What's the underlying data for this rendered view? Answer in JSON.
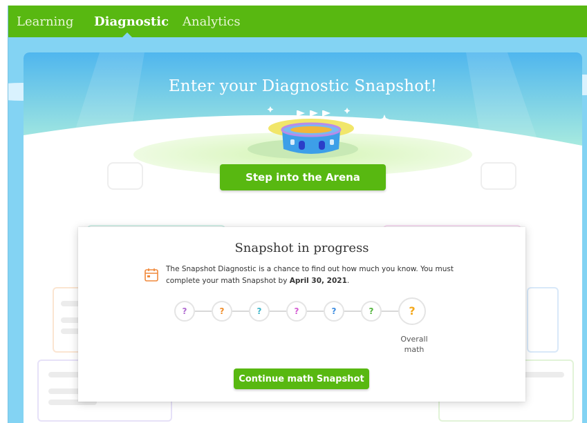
{
  "nav": {
    "tabs": [
      {
        "label": "Learning",
        "active": false
      },
      {
        "label": "Diagnostic",
        "active": true
      },
      {
        "label": "Analytics",
        "active": false
      }
    ]
  },
  "hero": {
    "title": "Enter your Diagnostic Snapshot!",
    "arena_button": "Step into the Arena",
    "illustration": "stadium-icon"
  },
  "snapshot": {
    "title": "Snapshot in progress",
    "desc_prefix": "The Snapshot Diagnostic is a chance to find out how much you know. You must complete your math Snapshot by ",
    "deadline": "April 30, 2021",
    "desc_suffix": ".",
    "steps": [
      {
        "label": "?",
        "color": "#b06ad0"
      },
      {
        "label": "?",
        "color": "#f08c28"
      },
      {
        "label": "?",
        "color": "#3cb4c8"
      },
      {
        "label": "?",
        "color": "#d45ad2"
      },
      {
        "label": "?",
        "color": "#3c8ce0"
      },
      {
        "label": "?",
        "color": "#52b43c"
      },
      {
        "label": "?",
        "color": "#f4a81c"
      }
    ],
    "overall_label": "Overall math",
    "continue_button": "Continue math Snapshot"
  },
  "colors": {
    "brand_green": "#58b811",
    "sky": "#83d3f3",
    "calendar_icon": "#f0883a"
  }
}
